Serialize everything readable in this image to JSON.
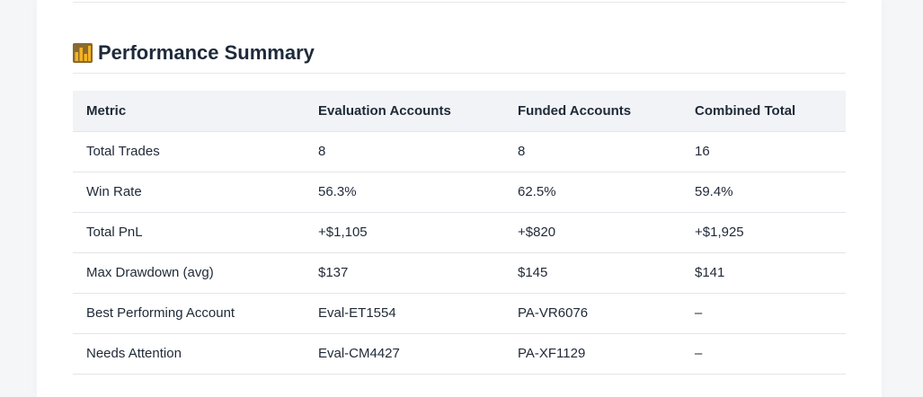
{
  "section": {
    "icon": "bar-chart-icon",
    "title": "Performance Summary"
  },
  "table": {
    "headers": [
      "Metric",
      "Evaluation Accounts",
      "Funded Accounts",
      "Combined Total"
    ],
    "rows": [
      [
        "Total Trades",
        "8",
        "8",
        "16"
      ],
      [
        "Win Rate",
        "56.3%",
        "62.5%",
        "59.4%"
      ],
      [
        "Total PnL",
        "+$1,105",
        "+$820",
        "+$1,925"
      ],
      [
        "Max Drawdown (avg)",
        "$137",
        "$145",
        "$141"
      ],
      [
        "Best Performing Account",
        "Eval-ET1554",
        "PA-VR6076",
        "–"
      ],
      [
        "Needs Attention",
        "Eval-CM4427",
        "PA-XF1129",
        "–"
      ]
    ]
  },
  "colors": {
    "title": "#1e2a3b",
    "header_bg": "#f1f3f7",
    "border": "#e2e5ea",
    "icon_bars": "#f5b323",
    "icon_bg": "#8a6a2e"
  }
}
